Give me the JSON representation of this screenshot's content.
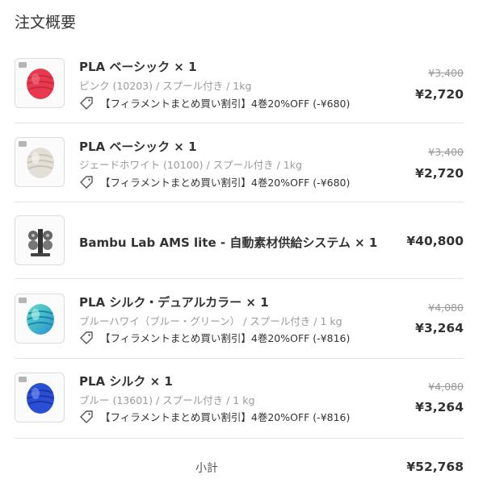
{
  "title": "注文概要",
  "items": [
    {
      "name": "PLA ベーシック × 1",
      "variant": "ピンク (10203) / スプール付き / 1kg",
      "promo": "【フィラメントまとめ買い割引】4巻20%OFF (-¥680)",
      "original_price": "¥3,400",
      "price": "¥2,720",
      "image": "spool-pink-image",
      "color": "#e8394f"
    },
    {
      "name": "PLA ベーシック × 1",
      "variant": "ジェードホワイト (10100) / スプール付き / 1kg",
      "promo": "【フィラメントまとめ買い割引】4巻20%OFF (-¥680)",
      "original_price": "¥3,400",
      "price": "¥2,720",
      "image": "spool-white-image",
      "color": "#e6e2da"
    },
    {
      "name": "Bambu Lab AMS lite - 自動素材供給システム × 1",
      "price": "¥40,800",
      "image": "ams-lite-image"
    },
    {
      "name": "PLA シルク・デュアルカラー × 1",
      "variant": "ブルーハワイ（ブルー・グリーン） / スプール付き / 1 kg",
      "promo": "【フィラメントまとめ買い割引】4巻20%OFF (-¥816)",
      "original_price": "¥4,080",
      "price": "¥3,264",
      "image": "spool-blue-green-image",
      "color": "#3cc7c0"
    },
    {
      "name": "PLA シルク × 1",
      "variant": "ブルー (13601) / スプール付き / 1 kg",
      "promo": "【フィラメントまとめ買い割引】4巻20%OFF (-¥816)",
      "original_price": "¥4,080",
      "price": "¥3,264",
      "image": "spool-blue-image",
      "color": "#2a4fd6"
    }
  ],
  "subtotal": {
    "label": "小計",
    "value": "¥52,768"
  }
}
